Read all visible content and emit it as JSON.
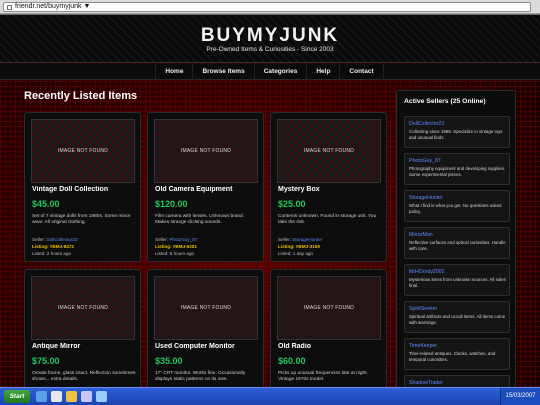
{
  "browser": {
    "url": "friendr.net/buymyjunk ▼"
  },
  "header": {
    "logo": "BUYMYJUNK",
    "tagline": "Pre-Owned Items & Curiosities - Since 2003"
  },
  "nav": [
    "Home",
    "Browse Items",
    "Categories",
    "Help",
    "Contact"
  ],
  "section_title": "Recently Listed Items",
  "image_placeholder": "IMAGE NOT FOUND",
  "labels": {
    "seller": "Seller: ",
    "listing": "Listing: "
  },
  "items": [
    {
      "title": "Vintage Doll Collection",
      "price": "$45.00",
      "desc": "Set of 7 vintage dolls from 1980s. Some minor wear. All original clothing.",
      "seller": "DollCollector23",
      "listing": "#BMJ-8472",
      "listed": "Listed: 2 hours ago"
    },
    {
      "title": "Old Camera Equipment",
      "price": "$120.00",
      "desc": "Film camera with lenses. Unknown brand. Makes strange clicking sounds.",
      "seller": "PhotoGuy_87",
      "listing": "#BMJ-6201",
      "listed": "Listed: 5 hours ago"
    },
    {
      "title": "Mystery Box",
      "price": "$25.00",
      "desc": "Contents unknown. Found in storage unit. You take the risk.",
      "seller": "StorageHunter",
      "listing": "#BMJ-3159",
      "listed": "Listed: 1 day ago"
    },
    {
      "title": "Antique Mirror",
      "price": "$75.00",
      "desc": "Ornate frame, glass intact. Reflection sometimes shows... extra details."
    },
    {
      "title": "Used Computer Monitor",
      "price": "$35.00",
      "desc": "17\" CRT monitor. Works fine. Occasionally displays static patterns on its own."
    },
    {
      "title": "Old Radio",
      "price": "$60.00",
      "desc": "Picks up unusual frequencies late at night. Vintage 1970s model."
    }
  ],
  "sidebar": {
    "title": "Active Sellers (25 Online)",
    "sellers": [
      {
        "name": "DollCollector23",
        "desc": "Collecting since 1999. Specialize in vintage toys and unusual finds."
      },
      {
        "name": "PhotoGuy_87",
        "desc": "Photography equipment and developing supplies. Some experimental pieces."
      },
      {
        "name": "StorageHunter",
        "desc": "What I find is what you get. No questions asked policy."
      },
      {
        "name": "MirrorMan",
        "desc": "Reflective surfaces and optical curiosities. Handle with care."
      },
      {
        "name": "MrHOordy2002",
        "desc": "Mysterious items from unknown sources. All sales final."
      },
      {
        "name": "SpiritSeeker",
        "desc": "Spiritual artifacts and occult items. All items come with warnings."
      },
      {
        "name": "TimeKeeper",
        "desc": "Time-related antiques. Clocks, watches, and temporal curiosities."
      },
      {
        "name": "ShadowTrader",
        "desc": ""
      }
    ]
  },
  "taskbar": {
    "start": "Start",
    "clock": "15/03/2007"
  },
  "colors": {
    "price": "#22c55e",
    "seller_link": "#5b8bff",
    "listing_id": "#f0c000"
  }
}
